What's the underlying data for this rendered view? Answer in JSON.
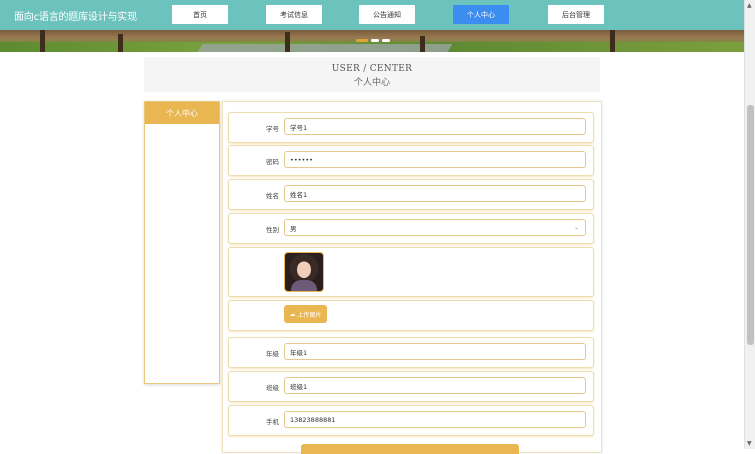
{
  "site": {
    "title": "面向c语言的题库设计与实现"
  },
  "nav": {
    "items": [
      {
        "label": "首页",
        "active": false
      },
      {
        "label": "考试信息",
        "active": false
      },
      {
        "label": "公告通知",
        "active": false
      },
      {
        "label": "个人中心",
        "active": true
      },
      {
        "label": "后台管理",
        "active": false
      }
    ]
  },
  "section": {
    "title_en": "USER / CENTER",
    "title_zh": "个人中心"
  },
  "sidebar": {
    "title": "个人中心"
  },
  "form": {
    "student_no": {
      "label": "学号",
      "value": "学号1"
    },
    "password": {
      "label": "密码",
      "value": "••••••"
    },
    "name": {
      "label": "姓名",
      "value": "姓名1"
    },
    "gender": {
      "label": "性别",
      "value": "男"
    },
    "upload_label": "上传图片",
    "grade": {
      "label": "年级",
      "value": "年级1"
    },
    "class": {
      "label": "班级",
      "value": "班级1"
    },
    "phone": {
      "label": "手机",
      "value": "13823888881"
    }
  },
  "colors": {
    "topbar": "#6cc3bd",
    "accent": "#e9b651",
    "active_nav": "#3b8df0"
  }
}
